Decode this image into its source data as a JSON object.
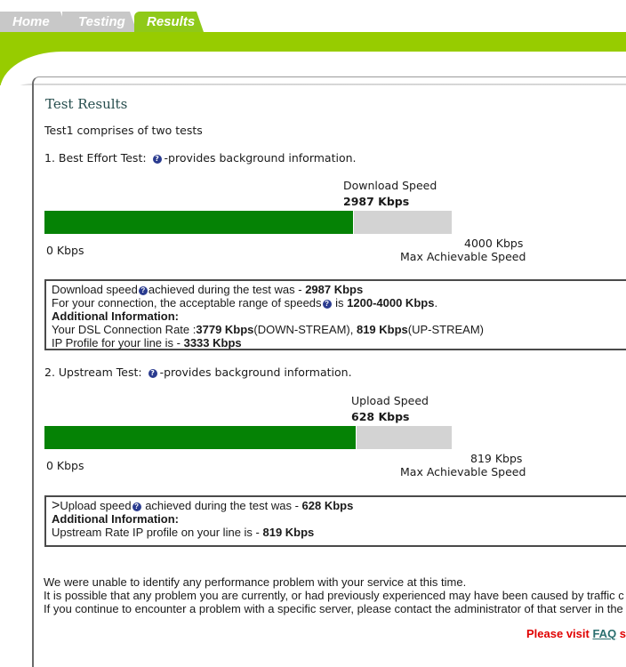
{
  "tabs": [
    {
      "label": "Home",
      "active": false
    },
    {
      "label": "Testing",
      "active": false
    },
    {
      "label": "Results",
      "active": true
    }
  ],
  "colors": {
    "accent": "#97cc00",
    "bar_fill": "#058205",
    "bar_track": "#d3d3d3",
    "link_red": "#e00000"
  },
  "page_title": "Test Results",
  "intro": "Test1 comprises of two tests",
  "download": {
    "heading": "1. Best Effort Test:",
    "heading_suffix": "-provides background information.",
    "speed_label": "Download  Speed",
    "speed_value": "2987 Kbps",
    "min_label": "0 Kbps",
    "max_value": "4000 Kbps",
    "max_label": "Max Achievable Speed",
    "fill_fraction": 0.7595
  },
  "download_info": {
    "line1_prefix": "Download speed",
    "line1_mid": "achieved during the test was - ",
    "line1_value": "2987 Kbps",
    "line2_prefix": "For your connection, the acceptable range of speeds",
    "line2_mid": " is ",
    "line2_value": "1200-4000 Kbps",
    "line2_suffix": ".",
    "additional": "Additional Information:",
    "line4_prefix": "Your DSL Connection Rate :",
    "line4_down": "3779 Kbps",
    "line4_down_label": "(DOWN-STREAM), ",
    "line4_up": "819 Kbps",
    "line4_up_label": "(UP-STREAM)",
    "line5_prefix": "IP Profile for your line is - ",
    "line5_value": "3333 Kbps"
  },
  "upload": {
    "heading": "2. Upstream Test:",
    "heading_suffix": "-provides background information.",
    "speed_label": "Upload Speed",
    "speed_value": "628 Kbps",
    "min_label": "0 Kbps",
    "max_value": "819 Kbps",
    "max_label": "Max Achievable Speed",
    "fill_fraction": 0.7668
  },
  "upload_info": {
    "marker": ">",
    "line1_prefix": "Upload speed",
    "line1_mid": " achieved during the test was - ",
    "line1_value": "628 Kbps",
    "additional": "Additional Information:",
    "line3_prefix": "Upstream Rate IP profile on your line is - ",
    "line3_value": "819 Kbps"
  },
  "footer": {
    "line1": "We were unable to identify any performance problem with your service at this time.",
    "line2": "It is possible that any problem you are currently, or had previously experienced may have been caused by traffic c",
    "line3": "If you continue to encounter a problem with a specific server, please contact the administrator of that server in the",
    "visit_prefix": "Please visit ",
    "visit_link": "FAQ",
    "visit_suffix": " s"
  },
  "help_glyph": "?"
}
